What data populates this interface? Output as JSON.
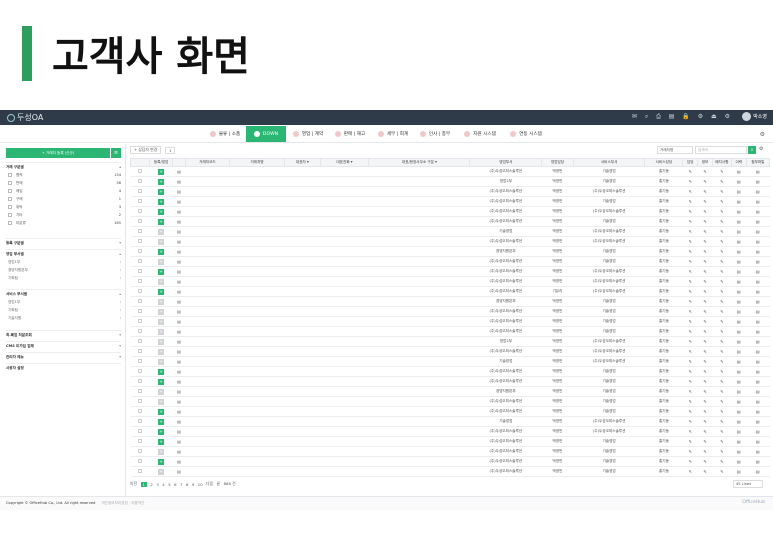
{
  "slide": {
    "title": "고객사 화면"
  },
  "app": {
    "logo": "두성OA",
    "user": "박소영",
    "top_icons": "✉ ⌕ ⎙ ▤ 🔒 ⚙ ⏏ ⚙"
  },
  "menu": {
    "tabs": [
      {
        "label": "물류 | 소품"
      },
      {
        "label": "DOWN"
      },
      {
        "label": "영업 | 계약"
      },
      {
        "label": "판매 | 재고"
      },
      {
        "label": "세무 | 회계"
      },
      {
        "label": "인사 | 총무"
      },
      {
        "label": "자원 시스템"
      },
      {
        "label": "연동 시스템"
      }
    ]
  },
  "sidebar": {
    "register_label": "+ 거래처 등록 (신규)",
    "section1": {
      "title": "거래 구분별",
      "items": [
        {
          "label": "협력",
          "count": "134"
        },
        {
          "label": "판매",
          "count": "36"
        },
        {
          "label": "매입",
          "count": "4"
        },
        {
          "label": "구매",
          "count": "1"
        },
        {
          "label": "위탁",
          "count": "3"
        },
        {
          "label": "기타",
          "count": "2"
        },
        {
          "label": "미분류",
          "count": "165"
        }
      ]
    },
    "section2": {
      "title": "등록 구분별"
    },
    "section3": {
      "title": "영업 부서별",
      "items": [
        {
          "label": "영업1부"
        },
        {
          "label": "경영지원본부"
        },
        {
          "label": "기획팀"
        }
      ]
    },
    "section4": {
      "title": "서비스 부서별",
      "items": [
        {
          "label": "영업1부"
        },
        {
          "label": "기획팀"
        },
        {
          "label": "기술지원"
        }
      ]
    },
    "section5": {
      "title": "최.폐업 처분조회"
    },
    "section6": {
      "title": "CMS 미가입 업체"
    },
    "section7": {
      "title": "관리자 메뉴"
    },
    "section8": {
      "title": "사용자 설정"
    }
  },
  "toolbar": {
    "filter_label": "+ 상담자 변경",
    "filter_count": "1",
    "select_value": "거래처명",
    "search_placeholder": "검색어"
  },
  "table": {
    "headers": [
      "",
      "등록/영업",
      "",
      "거래처코드",
      "거래처명",
      "대표자 ▾",
      "대표전화 ▾",
      "대표/현장사무소 구분 ▾",
      "영업부서",
      "영업담당",
      "서비스부서",
      "서비스담당",
      "담당",
      "정보",
      "폐지사항",
      "이력",
      "첨부파일"
    ],
    "rows": [
      {
        "g": "1",
        "dept": "(주)두성오피스솔루션",
        "rep": "박영민",
        "sdept": "기술영업",
        "srep": "홍기동"
      },
      {
        "g": "1",
        "dept": "영업2부",
        "rep": "박영민",
        "sdept": "기술영업",
        "srep": "홍기동"
      },
      {
        "g": "1",
        "dept": "(주)두성오피스솔루션",
        "rep": "박영민",
        "sdept": "(주)두성오피스솔루션",
        "srep": "홍기동"
      },
      {
        "g": "1",
        "dept": "(주)두성오피스솔루션",
        "rep": "박영민",
        "sdept": "기술영업",
        "srep": "홍기동"
      },
      {
        "g": "1",
        "dept": "(주)두성오피스솔루션",
        "rep": "박영민",
        "sdept": "(주)두성오피스솔루션",
        "srep": "홍기동"
      },
      {
        "g": "1",
        "dept": "(주)두성오피스솔루션",
        "rep": "박영민",
        "sdept": "기술영업",
        "srep": "홍기동"
      },
      {
        "g": "0",
        "dept": "기술영업",
        "rep": "박영민",
        "sdept": "(주)두성오피스솔루션",
        "srep": "홍기동"
      },
      {
        "g": "0",
        "dept": "(주)두성오피스솔루션",
        "rep": "박영민",
        "sdept": "(주)두성오피스솔루션",
        "srep": "홍기동"
      },
      {
        "g": "1",
        "dept": "경영지원본부",
        "rep": "박영민",
        "sdept": "기술영업",
        "srep": "홍기동"
      },
      {
        "g": "0",
        "dept": "(주)두성오피스솔루션",
        "rep": "박영민",
        "sdept": "기술영업",
        "srep": "홍기동"
      },
      {
        "g": "1",
        "dept": "(주)두성오피스솔루션",
        "rep": "박영민",
        "sdept": "(주)두성오피스솔루션",
        "srep": "홍기동"
      },
      {
        "g": "0",
        "dept": "(주)두성오피스솔루션",
        "rep": "박영민",
        "sdept": "(주)두성오피스솔루션",
        "srep": "홍기동"
      },
      {
        "g": "1",
        "dept": "(주)두성오피스솔루션",
        "rep": "기유리",
        "sdept": "(주)두성오피스솔루션",
        "srep": "홍기동"
      },
      {
        "g": "0",
        "dept": "경영지원본부",
        "rep": "박영민",
        "sdept": "기술영업",
        "srep": "홍기동"
      },
      {
        "g": "0",
        "dept": "(주)두성오피스솔루션",
        "rep": "박영민",
        "sdept": "기술영업",
        "srep": "홍기동"
      },
      {
        "g": "0",
        "dept": "(주)두성오피스솔루션",
        "rep": "박영민",
        "sdept": "기술영업",
        "srep": "홍기동"
      },
      {
        "g": "0",
        "dept": "(주)두성오피스솔루션",
        "rep": "박영민",
        "sdept": "기술영업",
        "srep": "홍기동"
      },
      {
        "g": "0",
        "dept": "영업2부",
        "rep": "박영민",
        "sdept": "(주)두성오피스솔루션",
        "srep": "홍기동"
      },
      {
        "g": "0",
        "dept": "(주)두성오피스솔루션",
        "rep": "박영민",
        "sdept": "(주)두성오피스솔루션",
        "srep": "홍기동"
      },
      {
        "g": "0",
        "dept": "기술영업",
        "rep": "박영민",
        "sdept": "(주)두성오피스솔루션",
        "srep": "홍기동"
      },
      {
        "g": "1",
        "dept": "(주)두성오피스솔루션",
        "rep": "박영민",
        "sdept": "기술영업",
        "srep": "홍기동"
      },
      {
        "g": "1",
        "dept": "(주)두성오피스솔루션",
        "rep": "박영민",
        "sdept": "기술영업",
        "srep": "홍기동"
      },
      {
        "g": "0",
        "dept": "경영지원본부",
        "rep": "박영민",
        "sdept": "기술영업",
        "srep": "홍기동"
      },
      {
        "g": "0",
        "dept": "(주)두성오피스솔루션",
        "rep": "박영민",
        "sdept": "기술영업",
        "srep": "홍기동"
      },
      {
        "g": "1",
        "dept": "(주)두성오피스솔루션",
        "rep": "박영민",
        "sdept": "기술영업",
        "srep": "홍기동"
      },
      {
        "g": "1",
        "dept": "기술영업",
        "rep": "박영민",
        "sdept": "(주)두성오피스솔루션",
        "srep": "홍기동"
      },
      {
        "g": "1",
        "dept": "(주)두성오피스솔루션",
        "rep": "박영민",
        "sdept": "(주)두성오피스솔루션",
        "srep": "홍기동"
      },
      {
        "g": "1",
        "dept": "(주)두성오피스솔루션",
        "rep": "박영민",
        "sdept": "기술영업",
        "srep": "홍기동"
      },
      {
        "g": "0",
        "dept": "(주)두성오피스솔루션",
        "rep": "박영민",
        "sdept": "기술영업",
        "srep": "홍기동"
      },
      {
        "g": "1",
        "dept": "(주)두성오피스솔루션",
        "rep": "박영민",
        "sdept": "기술영업",
        "srep": "홍기동"
      },
      {
        "g": "0",
        "dept": "(주)두성오피스솔루션",
        "rep": "박영민",
        "sdept": "기술영업",
        "srep": "홍기동"
      }
    ]
  },
  "pager": {
    "prev": "이전",
    "pages": [
      "1",
      "2",
      "3",
      "4",
      "5",
      "6",
      "7",
      "8",
      "9",
      "10"
    ],
    "next": "다음",
    "last": "끝",
    "total": "888 건",
    "per_page": "45 Lines"
  },
  "footer": {
    "copyright": "Copyright © OfficeHub Co., Ltd. All right reserved",
    "links": "개인정보처리방침 · 이용약관",
    "logo": "OfficeHub"
  }
}
